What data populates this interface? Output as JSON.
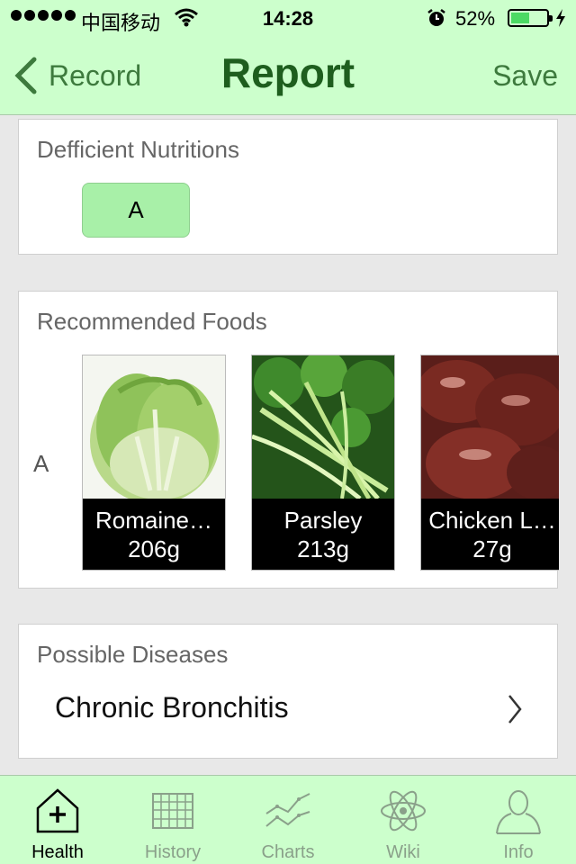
{
  "status_bar": {
    "carrier": "中国移动",
    "time": "14:28",
    "battery_percent": "52%",
    "battery_level": 0.52
  },
  "nav": {
    "back_label": "Record",
    "title": "Report",
    "save_label": "Save"
  },
  "deficient": {
    "heading": "Defficient Nutritions",
    "items": [
      "A"
    ]
  },
  "recommended": {
    "heading": "Recommended Foods",
    "row_label": "A",
    "foods": [
      {
        "name": "Romaine…",
        "amount": "206g",
        "image": "romaine-lettuce"
      },
      {
        "name": "Parsley",
        "amount": "213g",
        "image": "parsley"
      },
      {
        "name": "Chicken L…",
        "amount": "27g",
        "image": "chicken-liver"
      }
    ]
  },
  "diseases": {
    "heading": "Possible Diseases",
    "items": [
      "Chronic Bronchitis"
    ]
  },
  "tabs": [
    {
      "label": "Health",
      "icon": "health-icon",
      "active": true
    },
    {
      "label": "History",
      "icon": "history-icon",
      "active": false
    },
    {
      "label": "Charts",
      "icon": "charts-icon",
      "active": false
    },
    {
      "label": "Wiki",
      "icon": "wiki-icon",
      "active": false
    },
    {
      "label": "Info",
      "icon": "info-icon",
      "active": false
    }
  ],
  "colors": {
    "bar_background": "#ccffcc",
    "title_green": "#1e5e1e",
    "accent_green": "#3d7a3d",
    "chip_green": "#a8f0a8"
  }
}
